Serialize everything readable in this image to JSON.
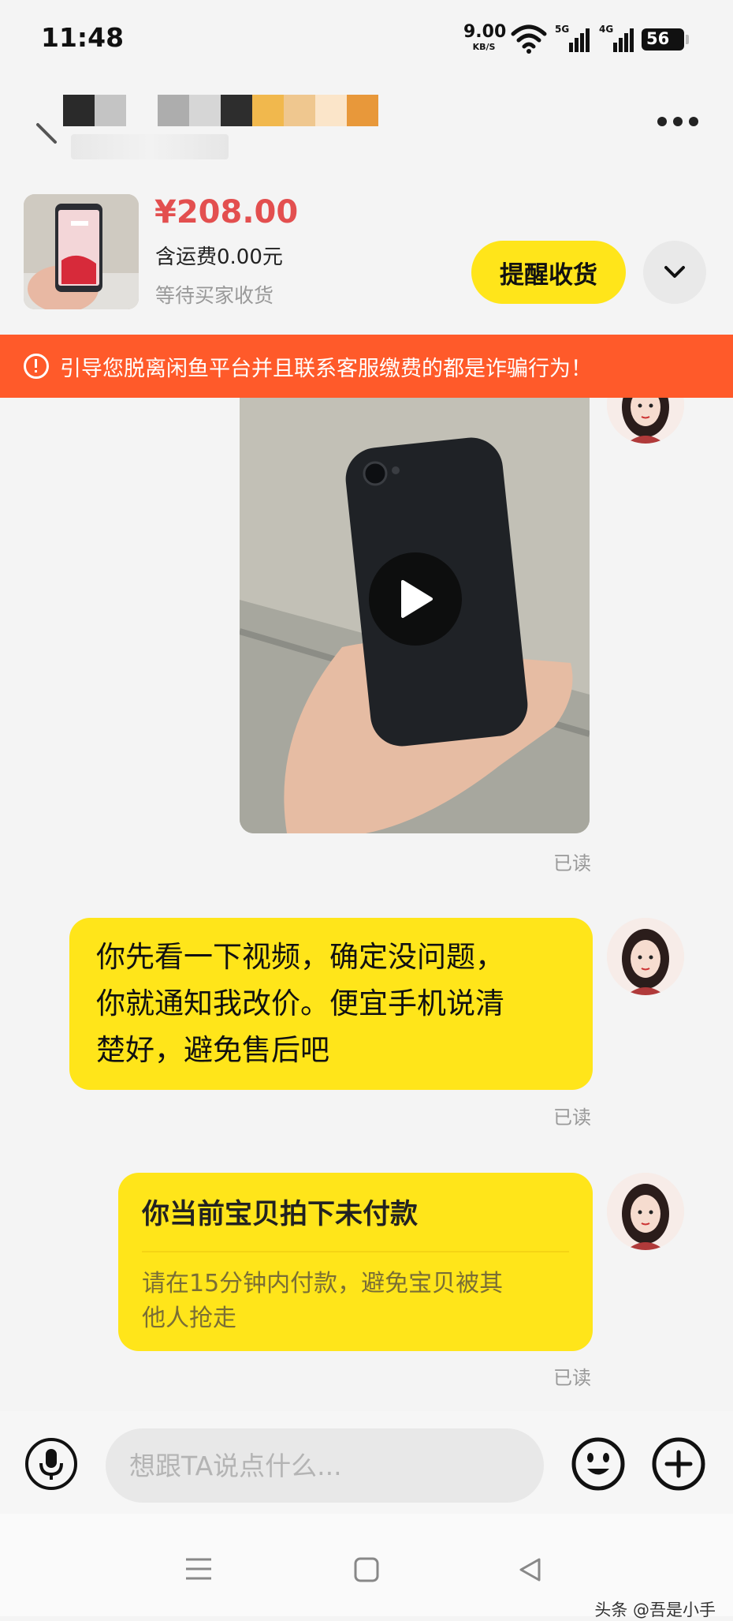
{
  "status_bar": {
    "time": "11:48",
    "net_speed_value": "9.00",
    "net_speed_unit": "KB/S",
    "signal1_label": "5G",
    "signal2_label": "4G",
    "battery": "56"
  },
  "product": {
    "price": "¥208.00",
    "shipping": "含运费0.00元",
    "status": "等待买家收货",
    "remind_button": "提醒收货"
  },
  "warning_banner": "引导您脱离闲鱼平台并且联系客服缴费的都是诈骗行为！",
  "messages": [
    {
      "type": "video",
      "read_status": "已读"
    },
    {
      "type": "text",
      "lines": [
        "你先看一下视频，确定没问题，",
        "你就通知我改价。便宜手机说清",
        "楚好，避免售后吧"
      ],
      "read_status": "已读"
    },
    {
      "type": "card",
      "title": "你当前宝贝拍下未付款",
      "body_lines": [
        "请在15分钟内付款，避免宝贝被其",
        "他人抢走"
      ],
      "read_status": "已读"
    }
  ],
  "input": {
    "placeholder": "想跟TA说点什么..."
  },
  "watermark": "头条 @吾是小手",
  "colors": {
    "accent_yellow": "#ffe51a",
    "warning_orange": "#ff5a2a",
    "price_red": "#e34f4f"
  }
}
